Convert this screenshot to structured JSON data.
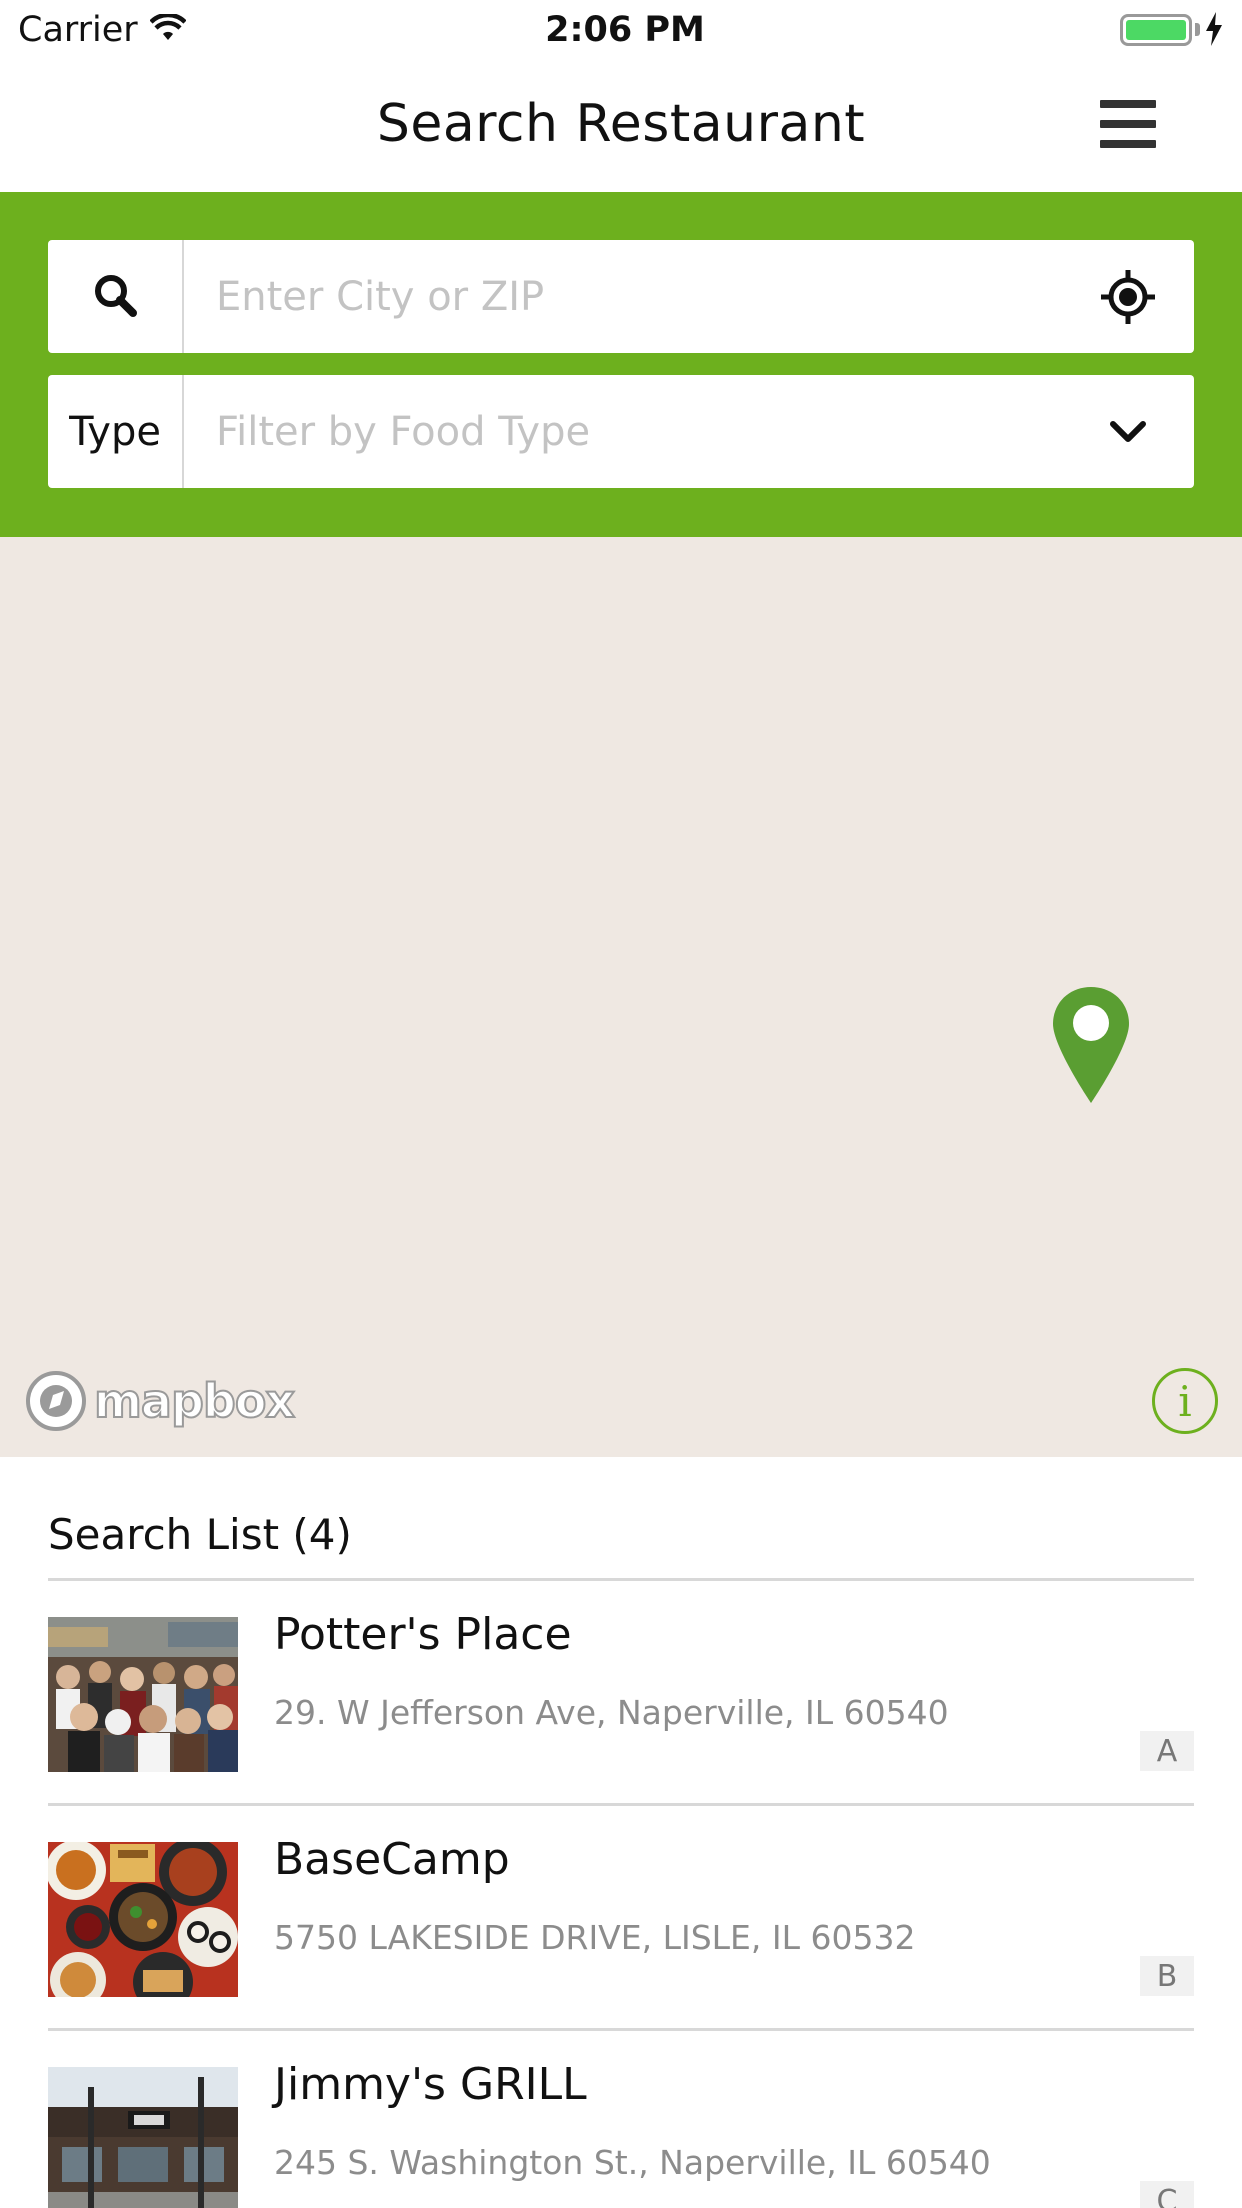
{
  "status_bar": {
    "carrier": "Carrier",
    "time": "2:06 PM",
    "battery_color": "#4cd964"
  },
  "nav": {
    "title": "Search Restaurant",
    "menu_icon": "hamburger-menu-icon"
  },
  "search": {
    "background_color": "#6db01e",
    "city_placeholder": "Enter City or ZIP",
    "city_value": "",
    "type_label": "Type",
    "type_placeholder": "Filter by Food Type",
    "type_value": ""
  },
  "map": {
    "background_color": "#efe8e2",
    "attribution_logo": "mapbox",
    "info_icon": "i",
    "pin_color": "#5a9e32"
  },
  "list": {
    "header": "Search List (4)",
    "items": [
      {
        "name": "Potter's Place",
        "address": "29. W Jefferson Ave, Naperville, IL 60540",
        "badge": "A"
      },
      {
        "name": "BaseCamp",
        "address": "5750 LAKESIDE DRIVE, LISLE, IL 60532",
        "badge": "B"
      },
      {
        "name": "Jimmy's GRILL",
        "address": "245 S. Washington St., Naperville, IL 60540",
        "badge": "C"
      }
    ]
  }
}
